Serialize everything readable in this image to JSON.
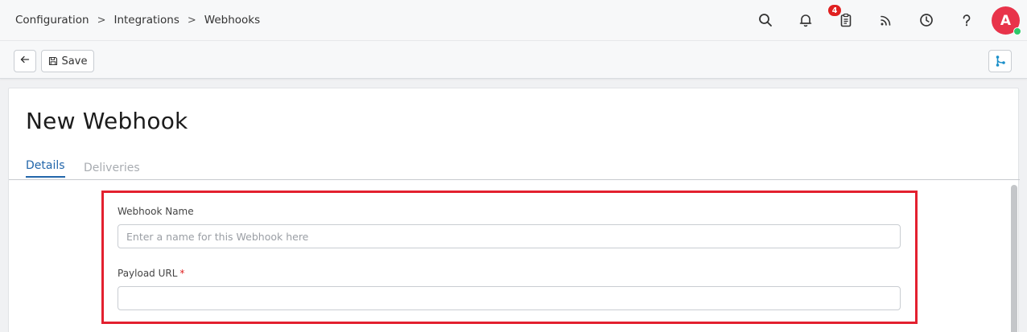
{
  "breadcrumb": {
    "items": [
      "Configuration",
      "Integrations",
      "Webhooks"
    ],
    "separator": ">"
  },
  "header": {
    "notification_badge": "4",
    "avatar_initial": "A",
    "icons": [
      "search-icon",
      "bell-icon",
      "clipboard-icon",
      "rss-icon",
      "clock-icon",
      "help-icon"
    ],
    "avatar_color": "#e8334a",
    "status_color": "#2ec96a"
  },
  "toolbar": {
    "back_icon": "arrow-left-icon",
    "save_label": "Save",
    "save_icon": "floppy-disk-icon",
    "flow_icon": "branch-icon",
    "flow_icon_color": "#1a8fc9"
  },
  "page": {
    "title": "New Webhook"
  },
  "tabs": [
    {
      "label": "Details",
      "active": true
    },
    {
      "label": "Deliveries",
      "active": false
    }
  ],
  "form": {
    "webhook_name": {
      "label": "Webhook Name",
      "placeholder": "Enter a name for this Webhook here",
      "value": ""
    },
    "payload_url": {
      "label": "Payload URL",
      "required_mark": "*",
      "placeholder": "",
      "value": ""
    }
  },
  "colors": {
    "accent": "#2266aa",
    "highlight": "#e3202f",
    "badge": "#e02020"
  }
}
